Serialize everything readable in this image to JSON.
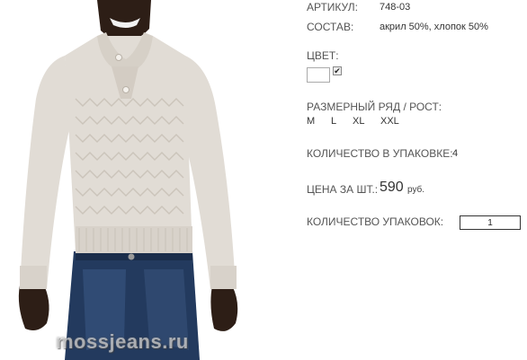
{
  "product": {
    "article": {
      "label": "АРТИКУЛ:",
      "value": "748-03"
    },
    "composition": {
      "label": "СОСТАВ:",
      "value": "акрил 50%, хлопок 50%"
    },
    "color": {
      "label": "ЦВЕТ:",
      "swatch": "#ffffff",
      "checked": true
    },
    "sizes": {
      "label": "РАЗМЕРНЫЙ РЯД / РОСТ:",
      "items": [
        "M",
        "L",
        "XL",
        "XXL"
      ]
    },
    "pack": {
      "label": "КОЛИЧЕСТВО В УПАКОВКЕ:",
      "value": "4"
    },
    "price": {
      "label": "ЦЕНА ЗА ШТ.:",
      "value": "590",
      "unit": "руб."
    },
    "order": {
      "label": "КОЛИЧЕСТВО УПАКОВОК:",
      "value": "1"
    }
  },
  "photo": {
    "watermark": "mossjeans.ru",
    "sweater_color": "#e1dcd5",
    "jeans_color": "#233a5e",
    "skin_color": "#2d1e16"
  }
}
